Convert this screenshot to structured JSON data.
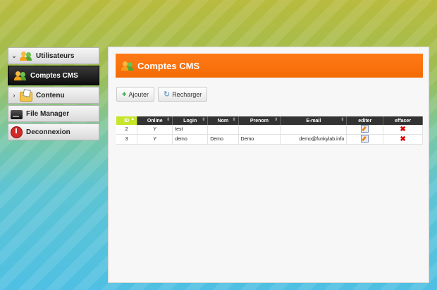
{
  "sidebar": {
    "items": [
      {
        "label": "Utilisateurs"
      },
      {
        "label": "Comptes CMS"
      },
      {
        "label": "Contenu"
      },
      {
        "label": "File Manager"
      },
      {
        "label": "Deconnexion"
      }
    ]
  },
  "panel": {
    "title": "Comptes CMS",
    "toolbar": {
      "add_label": "Ajouter",
      "reload_label": "Recharger"
    }
  },
  "table": {
    "columns": [
      "ID",
      "Online",
      "Login",
      "Nom",
      "Prenom",
      "E-mail",
      "editer",
      "effacer"
    ],
    "rows": [
      {
        "id": "2",
        "online": "Y",
        "login": "test",
        "nom": "",
        "prenom": "",
        "email": ""
      },
      {
        "id": "3",
        "online": "Y",
        "login": "demo",
        "nom": "Demo",
        "prenom": "Demo",
        "email": "demo@funkylab.info"
      }
    ]
  }
}
